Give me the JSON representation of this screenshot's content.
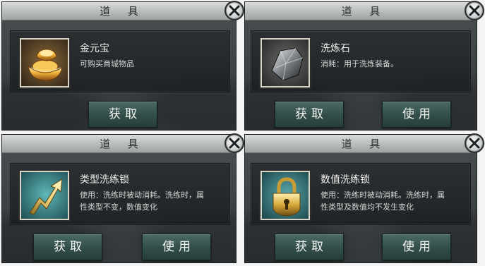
{
  "panels": [
    {
      "title": "道 具",
      "item": {
        "name": "金元宝",
        "desc": "可购买商城物品",
        "icon": "gold-ingot-icon"
      },
      "buttons": [
        "获取"
      ]
    },
    {
      "title": "道 具",
      "item": {
        "name": "洗炼石",
        "desc": "消耗：用于洗炼装备。",
        "icon": "refining-stone-icon"
      },
      "buttons": [
        "获取",
        "使用"
      ]
    },
    {
      "title": "道 具",
      "item": {
        "name": "类型洗练锁",
        "desc_line1": "使用：洗练时被动消耗。洗练时，属",
        "desc_line2": "性类型不变，数值变化",
        "icon": "type-lock-arrow-icon"
      },
      "buttons": [
        "获取",
        "使用"
      ]
    },
    {
      "title": "道 具",
      "item": {
        "name": "数值洗练锁",
        "desc_line1": "使用：洗练时被动消耗。洗练时，属",
        "desc_line2": "性类型及数值均不发生变化",
        "icon": "padlock-icon"
      },
      "buttons": [
        "获取",
        "使用"
      ]
    }
  ],
  "colors": {
    "title_bar": "#b7bbb9",
    "panel_bg": "#3c4144",
    "button": "#34504c",
    "text": "#f0f0ee"
  }
}
